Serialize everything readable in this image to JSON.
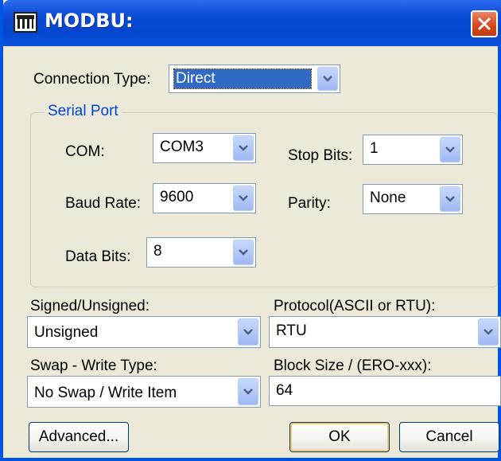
{
  "window": {
    "title": "MODBU:",
    "icon": "app-icon",
    "close_icon": "close-icon"
  },
  "connection_type": {
    "label": "Connection Type:",
    "value": "Direct"
  },
  "serial_port": {
    "title": "Serial Port",
    "com": {
      "label": "COM:",
      "value": "COM3"
    },
    "baud_rate": {
      "label": "Baud Rate:",
      "value": "9600"
    },
    "data_bits": {
      "label": "Data Bits:",
      "value": "8"
    },
    "stop_bits": {
      "label": "Stop Bits:",
      "value": "1"
    },
    "parity": {
      "label": "Parity:",
      "value": "None"
    }
  },
  "signed": {
    "label": "Signed/Unsigned:",
    "value": "Unsigned"
  },
  "protocol": {
    "label": "Protocol(ASCII or RTU):",
    "value": "RTU"
  },
  "swap": {
    "label": "Swap - Write Type:",
    "value": "No Swap / Write Item"
  },
  "block_size": {
    "label": "Block Size / (ERO-xxx):",
    "value": "64"
  },
  "buttons": {
    "advanced": "Advanced...",
    "ok": "OK",
    "cancel": "Cancel"
  },
  "colors": {
    "title_bar": "#0a4bd6",
    "face": "#ece9d8",
    "close": "#d5451b",
    "group_title": "#0046d5",
    "selection": "#316ac5"
  }
}
